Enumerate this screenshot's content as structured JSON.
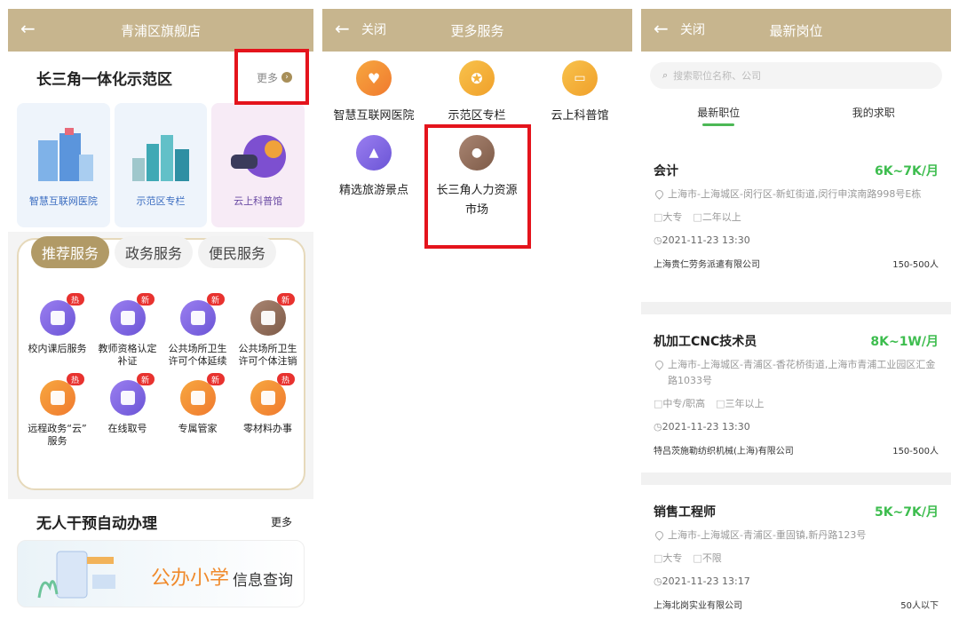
{
  "panel1": {
    "title": "青浦区旗舰店",
    "section_title": "长三角一体化示范区",
    "more": "更多",
    "cards": [
      {
        "label": "智慧互联网医院"
      },
      {
        "label": "示范区专栏"
      },
      {
        "label": "云上科普馆"
      }
    ],
    "tabs": [
      "推荐服务",
      "政务服务",
      "便民服务"
    ],
    "services": [
      {
        "label": "校内课后服务",
        "label2": "",
        "badge": "热",
        "color": "purple"
      },
      {
        "label": "教师资格认定",
        "label2": "补证",
        "badge": "新",
        "color": "purple"
      },
      {
        "label": "公共场所卫生",
        "label2": "许可个体延续",
        "badge": "新",
        "color": "purple"
      },
      {
        "label": "公共场所卫生",
        "label2": "许可个体注销",
        "badge": "新",
        "color": "brown"
      },
      {
        "label": "远程政务“云”",
        "label2": "服务",
        "badge": "热",
        "color": "orange"
      },
      {
        "label": "在线取号",
        "label2": "",
        "badge": "新",
        "color": "purple"
      },
      {
        "label": "专属管家",
        "label2": "",
        "badge": "新",
        "color": "orange"
      },
      {
        "label": "零材料办事",
        "label2": "",
        "badge": "热",
        "color": "orange"
      }
    ],
    "section2_title": "无人干预自动办理",
    "section2_more": "更多",
    "banner_main": "公办小学",
    "banner_sub": "信息查询"
  },
  "panel2": {
    "close": "关闭",
    "title": "更多服务",
    "items": [
      {
        "label": "智慧互联网医院",
        "label2": ""
      },
      {
        "label": "示范区专栏",
        "label2": ""
      },
      {
        "label": "云上科普馆",
        "label2": ""
      },
      {
        "label": "精选旅游景点",
        "label2": ""
      },
      {
        "label": "长三角人力资源",
        "label2": "市场"
      }
    ]
  },
  "panel3": {
    "close": "关闭",
    "title": "最新岗位",
    "search_placeholder": "搜索职位名称、公司",
    "tabs": [
      "最新职位",
      "我的求职"
    ],
    "jobs": [
      {
        "name": "会计",
        "salary": "6K~7K/月",
        "addr": "上海市-上海城区-闵行区-新虹街道,闵行申滨南路998号E栋",
        "edu": "大专",
        "exp": "二年以上",
        "time": "2021-11-23 13:30",
        "company": "上海贵仁劳务派遣有限公司",
        "size": "150-500人"
      },
      {
        "name": "机加工CNC技术员",
        "salary": "8K~1W/月",
        "addr": "上海市-上海城区-青浦区-香花桥街道,上海市青浦工业园区汇金路1033号",
        "edu": "中专/职高",
        "exp": "三年以上",
        "time": "2021-11-23 13:30",
        "company": "特吕茨施勒纺织机械(上海)有限公司",
        "size": "150-500人"
      },
      {
        "name": "销售工程师",
        "salary": "5K~7K/月",
        "addr": "上海市-上海城区-青浦区-重固镇,新丹路123号",
        "edu": "大专",
        "exp": "不限",
        "time": "2021-11-23 13:17",
        "company": "上海北岗实业有限公司",
        "size": "50人以下"
      }
    ]
  }
}
